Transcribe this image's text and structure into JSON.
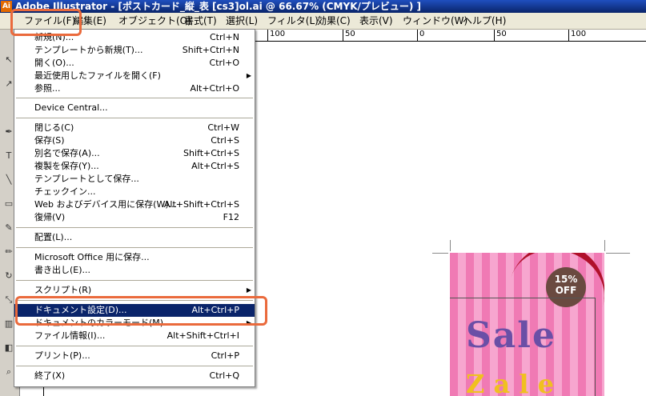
{
  "window": {
    "title": "Adobe Illustrator - [ポストカード_縦_表 [cs3]ol.ai @ 66.67% (CMYK/プレビュー) ]",
    "app_icon": "Ai"
  },
  "menubar": [
    "ファイル(F)",
    "編集(E)",
    "オブジェクト(O)",
    "書式(T)",
    "選択(L)",
    "フィルタ(L)",
    "効果(C)",
    "表示(V)",
    "ウィンドウ(W)",
    "ヘルプ(H)"
  ],
  "ruler": [
    "100",
    "50",
    "0",
    "50",
    "100"
  ],
  "file_menu": [
    {
      "label": "新規(N)...",
      "shortcut": "Ctrl+N"
    },
    {
      "label": "テンプレートから新規(T)...",
      "shortcut": "Shift+Ctrl+N"
    },
    {
      "label": "開く(O)...",
      "shortcut": "Ctrl+O"
    },
    {
      "label": "最近使用したファイルを開く(F)",
      "shortcut": "",
      "submenu": true
    },
    {
      "label": "参照...",
      "shortcut": "Alt+Ctrl+O"
    },
    {
      "label": "Device Central...",
      "shortcut": ""
    },
    {
      "label": "閉じる(C)",
      "shortcut": "Ctrl+W"
    },
    {
      "label": "保存(S)",
      "shortcut": "Ctrl+S"
    },
    {
      "label": "別名で保存(A)...",
      "shortcut": "Shift+Ctrl+S"
    },
    {
      "label": "複製を保存(Y)...",
      "shortcut": "Alt+Ctrl+S"
    },
    {
      "label": "テンプレートとして保存...",
      "shortcut": ""
    },
    {
      "label": "チェックイン...",
      "shortcut": ""
    },
    {
      "label": "Web およびデバイス用に保存(W)...",
      "shortcut": "Alt+Shift+Ctrl+S"
    },
    {
      "label": "復帰(V)",
      "shortcut": "F12"
    },
    {
      "label": "配置(L)...",
      "shortcut": ""
    },
    {
      "label": "Microsoft Office 用に保存...",
      "shortcut": ""
    },
    {
      "label": "書き出し(E)...",
      "shortcut": ""
    },
    {
      "label": "スクリプト(R)",
      "shortcut": "",
      "submenu": true
    },
    {
      "label": "ドキュメント設定(D)...",
      "shortcut": "Alt+Ctrl+P",
      "selected": true
    },
    {
      "label": "ドキュメントのカラーモード(M)",
      "shortcut": "",
      "submenu": true
    },
    {
      "label": "ファイル情報(I)...",
      "shortcut": "Alt+Shift+Ctrl+I"
    },
    {
      "label": "プリント(P)...",
      "shortcut": "Ctrl+P"
    },
    {
      "label": "終了(X)",
      "shortcut": "Ctrl+Q"
    }
  ],
  "card": {
    "badge_pct": "15%",
    "badge_off": "OFF",
    "sale": "Sale",
    "sale2": "Z a l e"
  },
  "colors": {
    "highlight": "#ea6a3c",
    "selection": "#0a246a"
  }
}
